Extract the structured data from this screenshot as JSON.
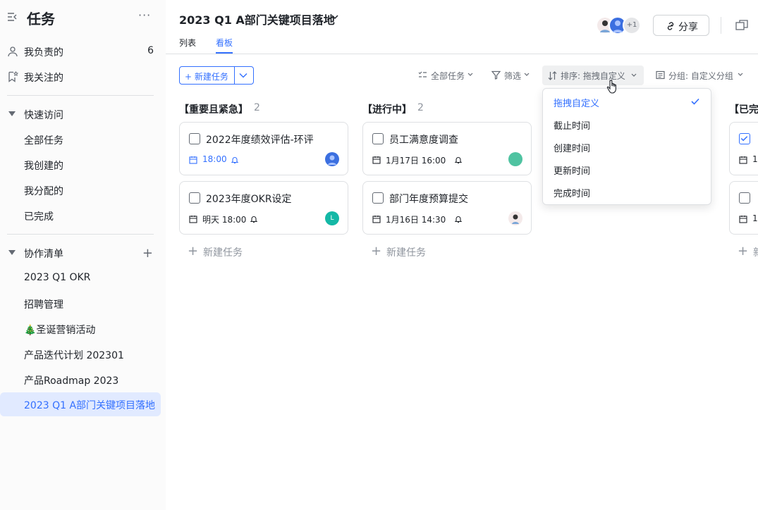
{
  "sidebar": {
    "title": "任务",
    "more_label": "···",
    "items_top": [
      {
        "label": "我负责的",
        "count": "6",
        "icon": "person-icon"
      },
      {
        "label": "我关注的",
        "icon": "star-bookmark-icon"
      }
    ],
    "quick_access": {
      "label": "快速访问",
      "items": [
        "全部任务",
        "我创建的",
        "我分配的",
        "已完成"
      ]
    },
    "collab": {
      "label": "协作清单",
      "add_label": "+",
      "items": [
        "2023 Q1 OKR",
        "招聘管理",
        "🎄圣诞营销活动",
        "产品迭代计划 202301",
        "产品Roadmap 2023",
        "2023 Q1 A部门关键项目落地"
      ],
      "active_index": 5
    }
  },
  "header": {
    "title": "2023 Q1 A部门关键项目落地",
    "tabs": [
      "列表",
      "看板"
    ],
    "active_tab": "看板",
    "avatar_overflow": "+1",
    "share_label": "分享"
  },
  "toolbar": {
    "new_task_label": "+ 新建任务",
    "all_tasks_label": "全部任务",
    "filter_label": "筛选",
    "sort_label": "排序:  拖拽自定义",
    "group_label": "分组:  自定义分组"
  },
  "columns": [
    {
      "name": "【重要且紧急】",
      "count": "2",
      "add_label": "新建任务",
      "cards": [
        {
          "title": "2022年度绩效评估-环评",
          "due": "18:00",
          "due_style": "blue",
          "avatar_color": "#3b6fe0",
          "avatar_text": ""
        },
        {
          "title": "2023年度OKR设定",
          "due": "明天 18:00",
          "due_style": "normal",
          "avatar_color": "#14b8a6",
          "avatar_text": "L"
        }
      ]
    },
    {
      "name": "【进行中】",
      "count": "2",
      "add_label": "新建任务",
      "cards": [
        {
          "title": "员工满意度调查",
          "due": "1月17日 16:00",
          "due_style": "normal",
          "avatar_color": "#4fc3a1",
          "avatar_text": ""
        },
        {
          "title": "部门年度预算提交",
          "due": "1月16日 14:30",
          "due_style": "normal",
          "avatar_color": "#f2e6e6",
          "avatar_text": ""
        }
      ]
    },
    {
      "name": "【已完",
      "count": "",
      "add_label": "新",
      "cards": [
        {
          "title": "",
          "due": "1",
          "checked": true
        },
        {
          "title": "",
          "due": "1",
          "checked": false
        }
      ]
    }
  ],
  "sort_menu": {
    "options": [
      "拖拽自定义",
      "截止时间",
      "创建时间",
      "更新时间",
      "完成时间"
    ],
    "selected_index": 0
  },
  "colors": {
    "accent": "#3370ff",
    "active_bg": "#e1eaff",
    "text": "#1f2329",
    "muted": "#646a73",
    "border": "#dee0e3"
  }
}
